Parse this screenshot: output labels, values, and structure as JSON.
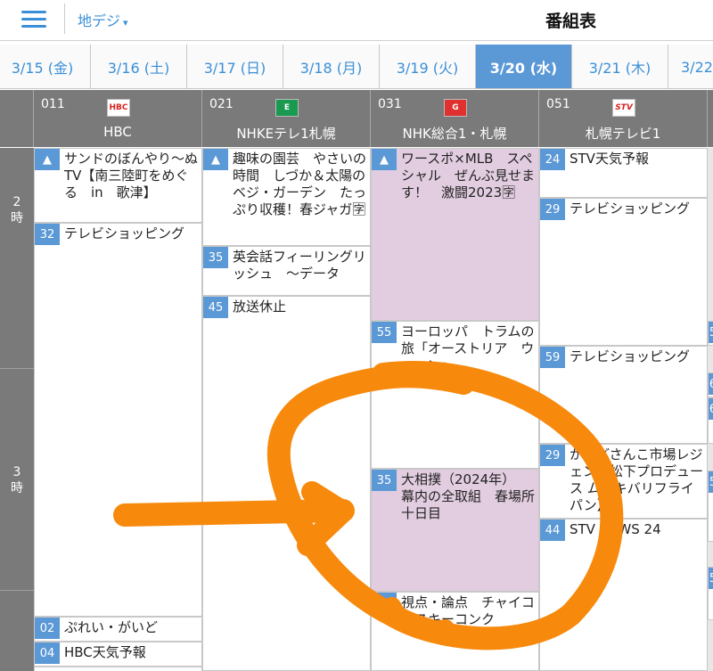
{
  "topbar": {
    "band_label": "地デジ",
    "band_caret": "▾",
    "title": "番組表"
  },
  "dates": [
    {
      "label": "3/15 (金)"
    },
    {
      "label": "3/16 (土)"
    },
    {
      "label": "3/17 (日)"
    },
    {
      "label": "3/18 (月)"
    },
    {
      "label": "3/19 (火)"
    },
    {
      "label": "3/20 (水)"
    },
    {
      "label": "3/21 (木)"
    },
    {
      "label": "3/22"
    }
  ],
  "active_date_index": 5,
  "channels": [
    {
      "number": "011",
      "logo": "HBC",
      "logo_color": "#d82020",
      "name": "HBC"
    },
    {
      "number": "021",
      "logo": "E",
      "logo_color": "#1a9a50",
      "name": "NHKEテレ1札幌"
    },
    {
      "number": "031",
      "logo": "G",
      "logo_color": "#e03030",
      "name": "NHK総合1・札幌"
    },
    {
      "number": "051",
      "logo": "STV",
      "logo_color": "#d82020",
      "name": "札幌テレビ1"
    }
  ],
  "hours": [
    {
      "label": "2\n時"
    },
    {
      "label": "3\n時"
    }
  ],
  "programs": {
    "hbc": [
      {
        "min": "▲",
        "title": "サンドのぼんやり～ぬTV【南三陸町をめぐる　in　歌津】"
      },
      {
        "min": "32",
        "title": "テレビショッピング"
      },
      {
        "min": "02",
        "title": "ぷれい・がいど"
      },
      {
        "min": "04",
        "title": "HBC天気予報"
      }
    ],
    "etele": [
      {
        "min": "▲",
        "title": "趣味の園芸　やさいの時間　しづか＆太陽のベジ・ガーデン　たっぷり収穫！春ジャガ🈑"
      },
      {
        "min": "35",
        "title": "英会話フィーリングリッシュ　～データ"
      },
      {
        "min": "45",
        "title": "放送休止"
      }
    ],
    "sogo": [
      {
        "min": "▲",
        "title": "ワースポ×MLB　スペシャル　ぜんぶ見せます！　激闘2023🈑"
      },
      {
        "min": "55",
        "title": "ヨーロッパ　トラムの旅「オーストリア　ウィーン」"
      },
      {
        "min": "35",
        "title": "大相撲（2024年）　幕内の全取組　春場所　十日目"
      },
      {
        "min": "",
        "title": "視点・論点　チャイコフスキーコンク"
      }
    ],
    "stv": [
      {
        "min": "24",
        "title": "STV天気予報"
      },
      {
        "min": "29",
        "title": "テレビショッピング"
      },
      {
        "min": "59",
        "title": "テレビショッピング"
      },
      {
        "min": "29",
        "title": "かしどさんこ市場レジェンド松下プロデュース ムテキバリフライパン】"
      },
      {
        "min": "44",
        "title": "STV NEWS 24"
      }
    ]
  },
  "partial_column_minutes": [
    "5",
    "6",
    "6",
    "5",
    "5"
  ]
}
